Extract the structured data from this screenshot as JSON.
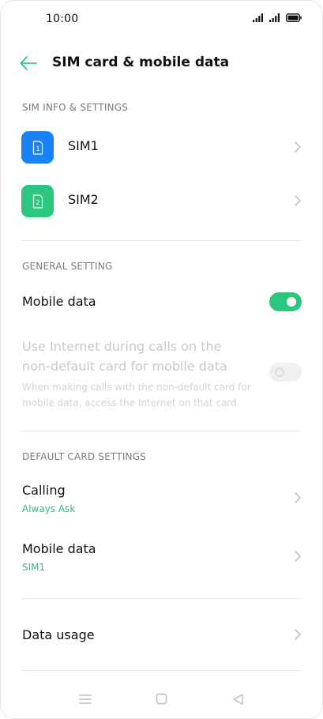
{
  "status_bar": {
    "time": "10:00"
  },
  "header": {
    "title": "SIM card & mobile data"
  },
  "sim_section": {
    "header": "SIM INFO & SETTINGS",
    "items": [
      {
        "label": "SIM1",
        "icon_number": "1",
        "color": "#1a82f7"
      },
      {
        "label": "SIM2",
        "icon_number": "2",
        "color": "#2bc77e"
      }
    ]
  },
  "general_section": {
    "header": "GENERAL SETTING",
    "mobile_data": {
      "label": "Mobile data",
      "enabled": true
    },
    "internet_during_calls": {
      "title_line1": "Use Internet during calls on the",
      "title_line2": "non-default card for mobile data",
      "desc_line1": "When making calls with the non-default card for",
      "desc_line2": "mobile data, access the Internet on that card.",
      "enabled": false,
      "disabled": true
    }
  },
  "default_section": {
    "header": "DEFAULT CARD SETTINGS",
    "calling": {
      "label": "Calling",
      "value": "Always Ask"
    },
    "mobile_data": {
      "label": "Mobile data",
      "value": "SIM1"
    }
  },
  "data_usage": {
    "label": "Data usage"
  },
  "colors": {
    "accent": "#2bc77e",
    "sim1_blue": "#1a82f7"
  },
  "nav_bar": {
    "icons": [
      "menu-icon",
      "home-icon",
      "back-icon"
    ]
  }
}
